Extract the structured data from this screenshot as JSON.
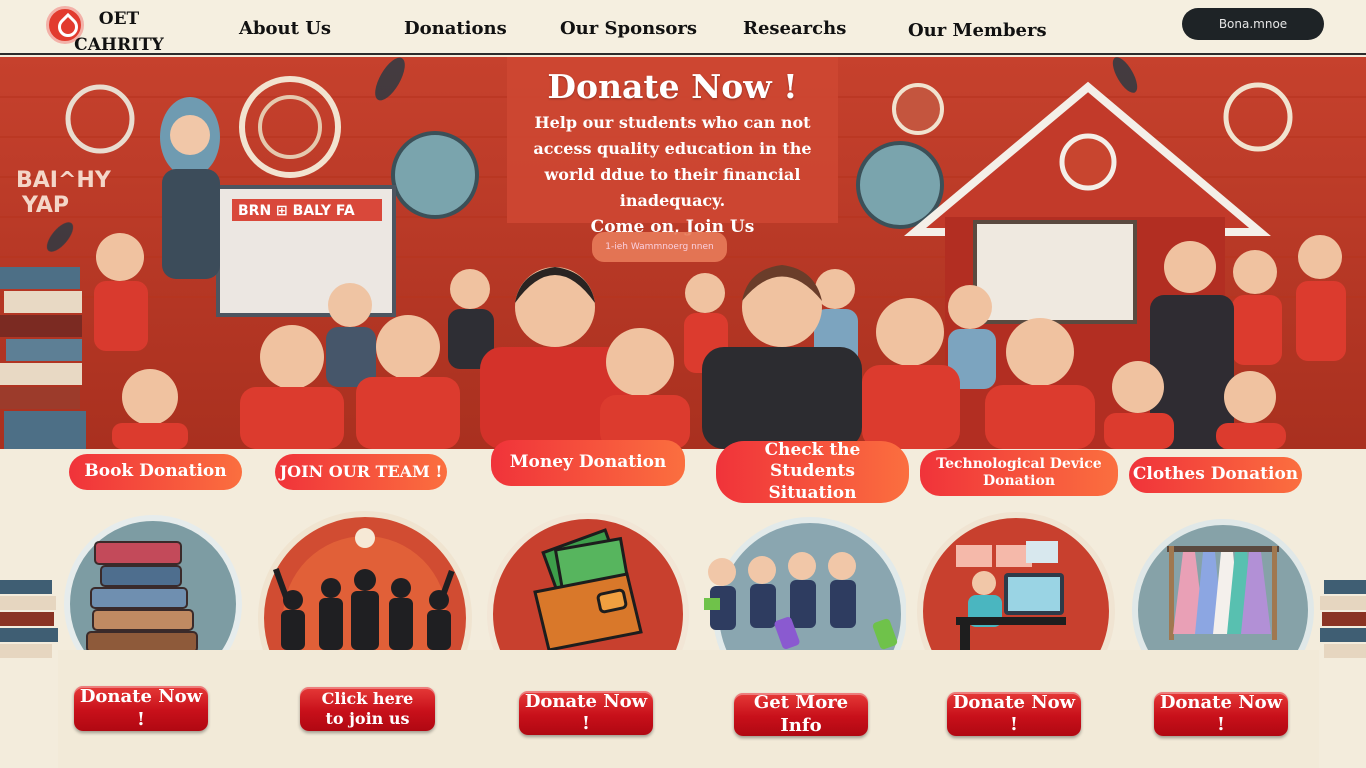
{
  "header": {
    "brand": "OET CAHRITY",
    "nav": [
      "About Us",
      "Donations",
      "Our  Sponsors",
      "Researchs",
      "Our Members"
    ],
    "cta": "Bona.mnoe"
  },
  "hero": {
    "title": "Donate Now !",
    "text": "Help our students who can not access quality education in the world ddue to their financial inadequacy.",
    "join": "Come on, Join Us",
    "cta": "1-ieh Wammnoerg nnen",
    "banner_left": "BAI^HY YAP",
    "board_text": "BRN ⊞ BALY FA"
  },
  "categories": [
    {
      "label": "Book Donation",
      "icon": "books-icon",
      "button": "Donate Now !"
    },
    {
      "label": "JOIN OUR TEAM !",
      "icon": "team-icon",
      "button": "Click here to join us"
    },
    {
      "label": "Money Donation",
      "icon": "wallet-icon",
      "button": "Donate Now !"
    },
    {
      "label": "Check the Students Situation",
      "icon": "students-icon",
      "button": "Get More Info"
    },
    {
      "label": "Technological  Device Donation",
      "icon": "computer-icon",
      "button": "Donate Now !"
    },
    {
      "label": "Clothes Donation",
      "icon": "clothes-icon",
      "button": "Donate Now !"
    }
  ],
  "colors": {
    "accent": "#e83a35",
    "background": "#f3ecdc",
    "hero": "#c8412c"
  }
}
